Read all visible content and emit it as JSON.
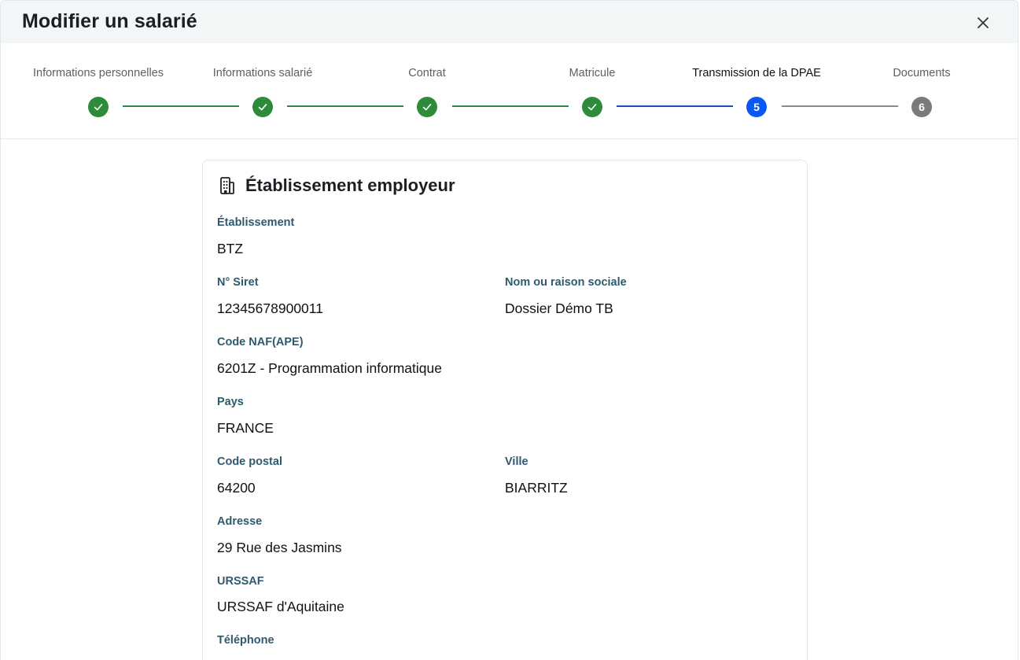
{
  "dialog": {
    "title": "Modifier un salarié"
  },
  "stepper": {
    "steps": [
      {
        "label": "Informations personnelles",
        "status": "done"
      },
      {
        "label": "Informations salarié",
        "status": "done"
      },
      {
        "label": "Contrat",
        "status": "done"
      },
      {
        "label": "Matricule",
        "status": "done"
      },
      {
        "label": "Transmission de la DPAE",
        "status": "current",
        "number": "5"
      },
      {
        "label": "Documents",
        "status": "todo",
        "number": "6"
      }
    ]
  },
  "card": {
    "title": "Établissement employeur",
    "icon": "building-icon",
    "fields": {
      "etablissement": {
        "label": "Établissement",
        "value": "BTZ"
      },
      "siret": {
        "label": "N° Siret",
        "value": "12345678900011"
      },
      "raison_sociale": {
        "label": "Nom ou raison sociale",
        "value": "Dossier Démo TB"
      },
      "code_naf": {
        "label": "Code NAF(APE)",
        "value": "6201Z - Programmation informatique"
      },
      "pays": {
        "label": "Pays",
        "value": "FRANCE"
      },
      "code_postal": {
        "label": "Code postal",
        "value": "64200"
      },
      "ville": {
        "label": "Ville",
        "value": "BIARRITZ"
      },
      "adresse": {
        "label": "Adresse",
        "value": "29 Rue des Jasmins"
      },
      "urssaf": {
        "label": "URSSAF",
        "value": "URSSAF d'Aquitaine"
      },
      "telephone": {
        "label": "Téléphone",
        "value": ""
      }
    }
  },
  "colors": {
    "done": "#2e8b3a",
    "current": "#0b57f5",
    "todo": "#7a7a7a",
    "label": "#2f5a6e"
  }
}
